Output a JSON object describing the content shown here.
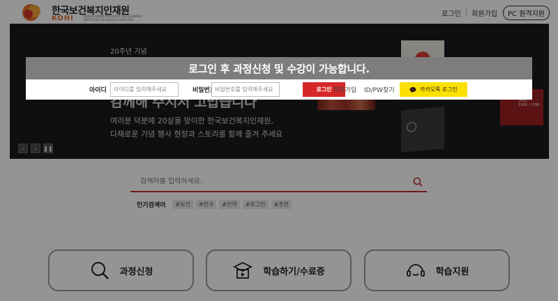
{
  "header": {
    "logo_ko": "한국보건복지인재원",
    "logo_en": "KOHI",
    "logo_sub": "KOREA HUMAN RESOURCE DEVELOPMENT INSTITUTE FOR HEALTH & WELFARE",
    "links": [
      "로그인",
      "회원가입"
    ],
    "pc_remote": "PC 원격지원"
  },
  "banner": {
    "tag": "20주년 기념",
    "headline": "감께해 주시서 고맙습니다",
    "line1": "여러분 덕분에 20살을 맞이한 한국보건복지인재원,",
    "line2": "다채로운 기념 행사 현장과 스토리를 함께 즐겨 주세요",
    "controls": [
      "‹",
      "›",
      "❚❚"
    ]
  },
  "search": {
    "placeholder": "검색어를 입력하세요.",
    "popular_label": "인기검색어",
    "popular_tags": [
      "#보건",
      "#한국",
      "#인력",
      "#로그인",
      "#추천"
    ]
  },
  "quick_menu": [
    {
      "label": "과정신청",
      "icon": "search-icon"
    },
    {
      "label": "학습하기/수료증",
      "icon": "graduation-cap-icon"
    },
    {
      "label": "학습지원",
      "icon": "headset-icon"
    }
  ],
  "login_modal": {
    "title": "로그인 후 과정신청 및 수강이 가능합니다.",
    "id_label": "아이디",
    "id_placeholder": "아이디를 입력해주세요",
    "pw_label": "비밀번호",
    "pw_placeholder": "비밀번호를 입력해주세요",
    "login_button": "로그인",
    "join_link": "회원가입",
    "find_link": "ID/PW찾기",
    "kakao_button": "카카오톡 로그인"
  },
  "colors": {
    "accent_red": "#d52727",
    "kakao_yellow": "#fae100",
    "logo_orange": "#e36b2c"
  }
}
